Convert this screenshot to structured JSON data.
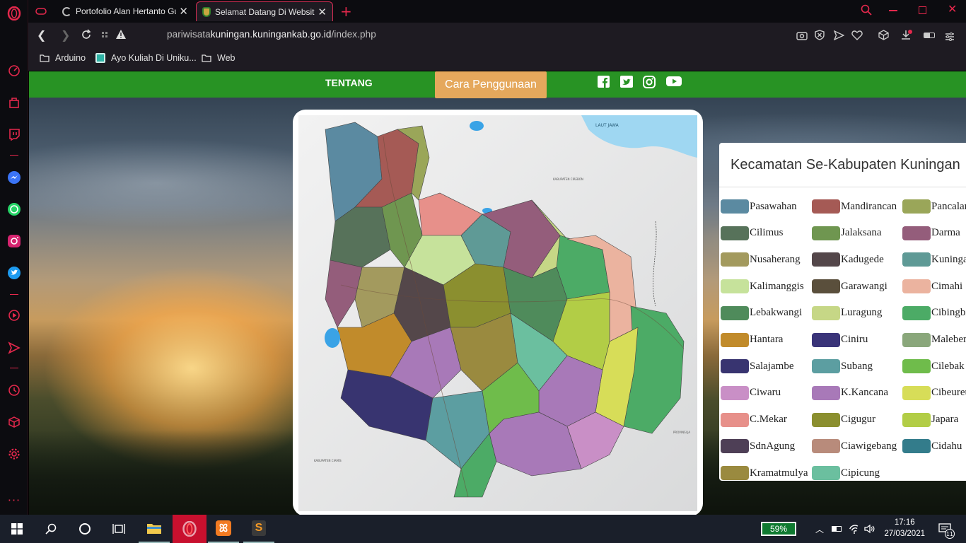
{
  "browser": {
    "tabs": [
      {
        "title": "Portofolio Alan Hertanto Gu"
      },
      {
        "title": "Selamat Datang Di Website"
      }
    ],
    "url_prefix": "pariwisata",
    "url_domain": "kuningan.kuningankab.go.id",
    "url_path": "/index.php",
    "bookmarks": [
      {
        "label": "Arduino",
        "icon": "folder-icon"
      },
      {
        "label": "Ayo Kuliah Di Uniku...",
        "icon": "site-icon"
      },
      {
        "label": "Web",
        "icon": "folder-icon"
      }
    ]
  },
  "site": {
    "nav": {
      "tentang": "TENTANG",
      "cara": "Cara Penggunaan",
      "social": [
        "facebook-icon",
        "twitter-icon",
        "instagram-icon",
        "youtube-icon"
      ]
    },
    "map_labels": {
      "sea": "LAUT JAWA",
      "cirebon": "KABUPATEN CIREBON",
      "brebes": "PROVINSI JA",
      "ciamis": "KABUPATEN CIAMIS"
    },
    "legend": {
      "title": "Kecamatan Se-Kabupaten Kuningan",
      "items": [
        {
          "name": "Pasawahan",
          "color": "#5b8aa1"
        },
        {
          "name": "Mandirancan",
          "color": "#a55a55"
        },
        {
          "name": "Pancalang",
          "color": "#9aa659"
        },
        {
          "name": "Cilimus",
          "color": "#57725a"
        },
        {
          "name": "Jalaksana",
          "color": "#6f9650"
        },
        {
          "name": "Darma",
          "color": "#945d7b"
        },
        {
          "name": "Nusaherang",
          "color": "#a39a5e"
        },
        {
          "name": "Kadugede",
          "color": "#54474a"
        },
        {
          "name": "Kuningan",
          "color": "#5f9a96"
        },
        {
          "name": "Kalimanggis",
          "color": "#c6e29b"
        },
        {
          "name": "Garawangi",
          "color": "#5a4f3c"
        },
        {
          "name": "Cimahi",
          "color": "#ebb39f"
        },
        {
          "name": "Lebakwangi",
          "color": "#4f8b5b"
        },
        {
          "name": "Luragung",
          "color": "#c6d786"
        },
        {
          "name": "Cibingbin",
          "color": "#4cab66"
        },
        {
          "name": "Hantara",
          "color": "#c18b2b"
        },
        {
          "name": "Ciniru",
          "color": "#3a3479"
        },
        {
          "name": "Maleber",
          "color": "#8aa77b"
        },
        {
          "name": "Salajambe",
          "color": "#383470"
        },
        {
          "name": "Subang",
          "color": "#5c9ea1"
        },
        {
          "name": "Cilebak",
          "color": "#6fbc4b"
        },
        {
          "name": "Ciwaru",
          "color": "#c98fc6"
        },
        {
          "name": "K.Kancana",
          "color": "#a879b8"
        },
        {
          "name": "Cibeureum",
          "color": "#d7dd58"
        },
        {
          "name": "C.Mekar",
          "color": "#e7908a"
        },
        {
          "name": "Cigugur",
          "color": "#8b8f2f"
        },
        {
          "name": "Japara",
          "color": "#b2cd46"
        },
        {
          "name": "SdnAgung",
          "color": "#4e3f56"
        },
        {
          "name": "Ciawigebang",
          "color": "#b88b7b"
        },
        {
          "name": "Cidahu",
          "color": "#337c8b"
        },
        {
          "name": "Kramatmulya",
          "color": "#9a8a3f"
        },
        {
          "name": "Cipicung",
          "color": "#6bbf9f"
        }
      ]
    }
  },
  "taskbar": {
    "battery": "59%",
    "time": "17:16",
    "date": "27/03/2021",
    "notifications": "11"
  }
}
